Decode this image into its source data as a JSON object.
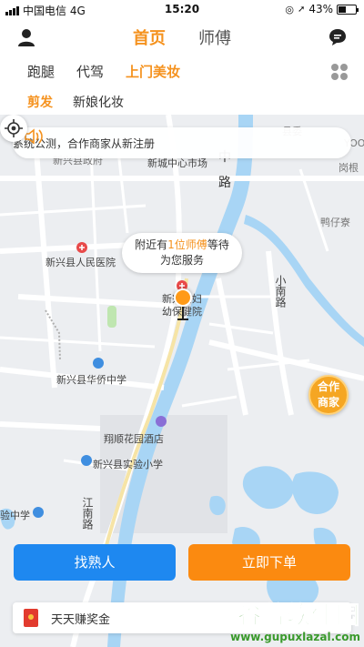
{
  "status": {
    "carrier": "中国电信 4G",
    "time": "15:20",
    "battery": "43%",
    "battery_level": 0.43
  },
  "header": {
    "tabs": [
      {
        "label": "首页",
        "active": true
      },
      {
        "label": "师傅",
        "active": false
      }
    ]
  },
  "services": [
    {
      "label": "跑腿"
    },
    {
      "label": "代驾"
    },
    {
      "label": "上门美妆",
      "active": true
    }
  ],
  "subservices": [
    {
      "label": "剪发",
      "active": true
    },
    {
      "label": "新娘化妆"
    }
  ],
  "notice": {
    "text": "系统公测，合作商家从新注册"
  },
  "map": {
    "labels": {
      "county_gov": "新兴县政府",
      "city_center_market": "新城中心市场",
      "town_center_road_1": "中",
      "town_center_road_2": "路",
      "mingxiang_road": "小南路",
      "people_hospital": "新兴县人民医院",
      "maternity_hospital_1": "新兴县妇",
      "maternity_hospital_2": "幼保健院",
      "huaqiao_school": "新兴县华侨中学",
      "xiangshun_hotel": "翔顺花园酒店",
      "experimental_school": "新兴县实验小学",
      "gangtou": "岗根",
      "yazai": "鸭仔寮",
      "jiangbei_road": "江南路",
      "middle_school_partial": "验中学",
      "north_partial": "县委",
      "top_right": "YOO"
    },
    "bubble": {
      "prefix": "附近有",
      "highlight": "1位师傅",
      "suffix": "等待",
      "line2": "为您服务"
    },
    "partner": {
      "line1": "合作",
      "line2": "商家"
    }
  },
  "actions": {
    "left": "找熟人",
    "right": "立即下单"
  },
  "reward": {
    "text": "天天赚奖金"
  },
  "watermark": {
    "line1": "谷普软件园",
    "line2": "www.gupuxlazal.com"
  },
  "colors": {
    "accent": "#f5921e",
    "primary": "#1e88f0",
    "order": "#fb8a10",
    "river": "#a8d5f5"
  }
}
